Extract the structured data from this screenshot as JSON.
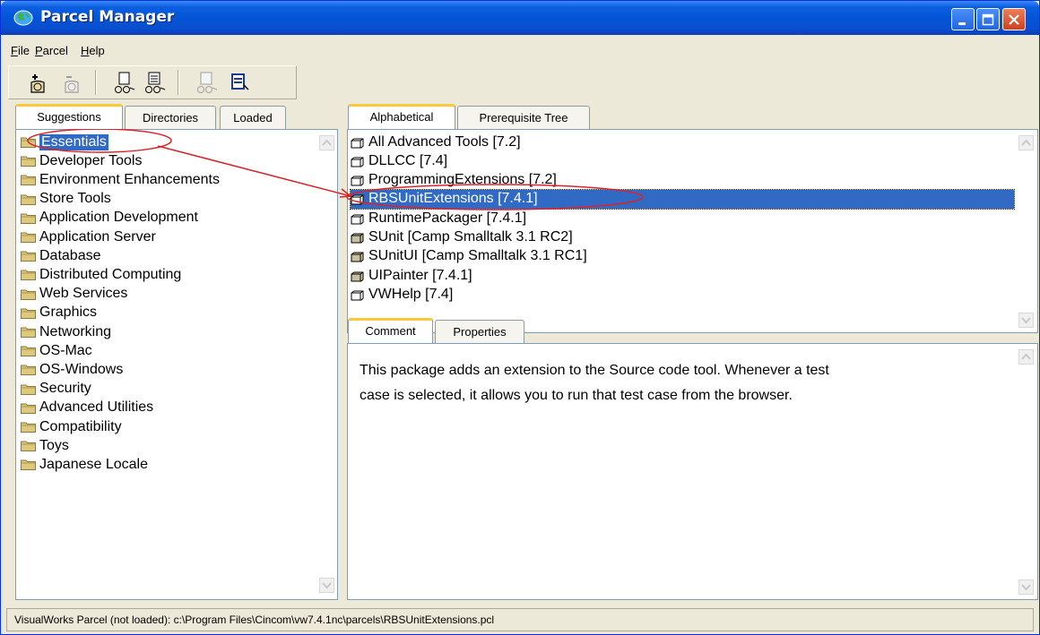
{
  "window": {
    "title": "Parcel Manager"
  },
  "menu": [
    {
      "label_first": "F",
      "label_rest": "ile"
    },
    {
      "label_first": "P",
      "label_rest": "arcel"
    },
    {
      "label_first": "H",
      "label_rest": "elp"
    }
  ],
  "toolbar": {
    "icons": [
      "load-parcel-icon",
      "unload-parcel-icon",
      "find-parcel-icon",
      "browse-parcel-icon",
      "prerequisites-icon",
      "properties-icon"
    ]
  },
  "left_tabs": [
    "Suggestions",
    "Directories",
    "Loaded"
  ],
  "categories": [
    "Essentials",
    "Developer Tools",
    "Environment Enhancements",
    "Store Tools",
    "Application Development",
    "Application Server",
    "Database",
    "Distributed Computing",
    "Web Services",
    "Graphics",
    "Networking",
    "OS-Mac",
    "OS-Windows",
    "Security",
    "Advanced Utilities",
    "Compatibility",
    "Toys",
    "Japanese Locale"
  ],
  "selected_category": "Essentials",
  "right_tabs": [
    "Alphabetical",
    "Prerequisite Tree"
  ],
  "parcels": [
    {
      "name": "All Advanced Tools [7.2]",
      "loaded": false
    },
    {
      "name": "DLLCC [7.4]",
      "loaded": false
    },
    {
      "name": "ProgrammingExtensions [7.2]",
      "loaded": false
    },
    {
      "name": "RBSUnitExtensions [7.4.1]",
      "loaded": false
    },
    {
      "name": "RuntimePackager [7.4.1]",
      "loaded": false
    },
    {
      "name": "SUnit [Camp Smalltalk 3.1 RC2]",
      "loaded": true
    },
    {
      "name": "SUnitUI [Camp Smalltalk 3.1 RC1]",
      "loaded": true
    },
    {
      "name": "UIPainter [7.4.1]",
      "loaded": true
    },
    {
      "name": "VWHelp [7.4]",
      "loaded": false
    }
  ],
  "selected_parcel": "RBSUnitExtensions [7.4.1]",
  "detail_tabs": [
    "Comment",
    "Properties"
  ],
  "comment_line1": "This package adds an extension to the Source code tool. Whenever a test",
  "comment_line2": "case is selected, it allows you to run that test case from the browser.",
  "status": "VisualWorks Parcel (not loaded): c:\\Program Files\\Cincom\\vw7.4.1nc\\parcels\\RBSUnitExtensions.pcl",
  "colors": {
    "title_bar": "#0454d6",
    "selection": "#316ac5",
    "annotation": "#d9232a",
    "tab_highlight": "#ffc83c"
  }
}
